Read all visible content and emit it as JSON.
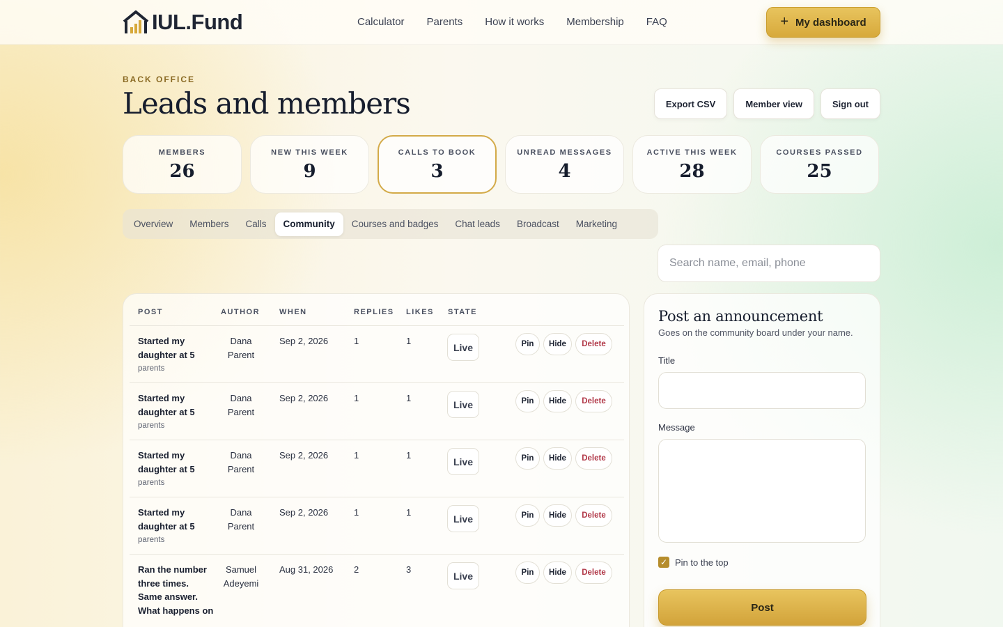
{
  "header": {
    "logo_text": "IUL.Fund",
    "nav": [
      "Calculator",
      "Parents",
      "How it works",
      "Membership",
      "FAQ"
    ],
    "dashboard_label": "My dashboard"
  },
  "page": {
    "eyebrow": "BACK OFFICE",
    "title": "Leads and members",
    "actions": [
      "Export CSV",
      "Member view",
      "Sign out"
    ]
  },
  "stats": [
    {
      "label": "MEMBERS",
      "value": "26"
    },
    {
      "label": "NEW THIS WEEK",
      "value": "9"
    },
    {
      "label": "CALLS TO BOOK",
      "value": "3"
    },
    {
      "label": "UNREAD MESSAGES",
      "value": "4"
    },
    {
      "label": "ACTIVE THIS WEEK",
      "value": "28"
    },
    {
      "label": "COURSES PASSED",
      "value": "25"
    }
  ],
  "tabs": [
    "Overview",
    "Members",
    "Calls",
    "Community",
    "Courses and badges",
    "Chat leads",
    "Broadcast",
    "Marketing"
  ],
  "active_tab": "Community",
  "search": {
    "placeholder": "Search name, email, phone"
  },
  "table": {
    "columns": [
      "POST",
      "AUTHOR",
      "WHEN",
      "REPLIES",
      "LIKES",
      "STATE"
    ],
    "row_actions": {
      "pin": "Pin",
      "hide": "Hide",
      "delete": "Delete"
    },
    "rows": [
      {
        "title": "Started my daughter at 5",
        "tag": "parents",
        "author": "Dana Parent",
        "when": "Sep 2, 2026",
        "replies": "1",
        "likes": "1",
        "state": "Live"
      },
      {
        "title": "Started my daughter at 5",
        "tag": "parents",
        "author": "Dana Parent",
        "when": "Sep 2, 2026",
        "replies": "1",
        "likes": "1",
        "state": "Live"
      },
      {
        "title": "Started my daughter at 5",
        "tag": "parents",
        "author": "Dana Parent",
        "when": "Sep 2, 2026",
        "replies": "1",
        "likes": "1",
        "state": "Live"
      },
      {
        "title": "Started my daughter at 5",
        "tag": "parents",
        "author": "Dana Parent",
        "when": "Sep 2, 2026",
        "replies": "1",
        "likes": "1",
        "state": "Live"
      },
      {
        "title": "Ran the number three times. Same answer. What happens on",
        "tag": "",
        "author": "Samuel Adeyemi",
        "when": "Aug 31, 2026",
        "replies": "2",
        "likes": "3",
        "state": "Live"
      }
    ]
  },
  "announcement": {
    "title": "Post an announcement",
    "subtitle": "Goes on the community board under your name.",
    "title_label": "Title",
    "title_value": "",
    "message_label": "Message",
    "message_value": "",
    "pin_label": "Pin to the top",
    "pin_checked": true,
    "submit_label": "Post"
  },
  "colors": {
    "accent_gold": "#d7a93b",
    "delete_red": "#b23a4a"
  }
}
